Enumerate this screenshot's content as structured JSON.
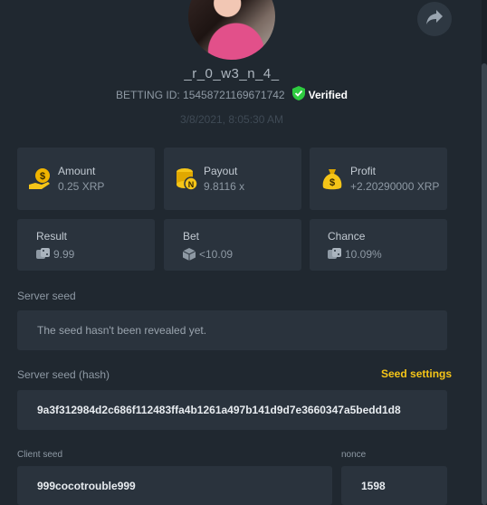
{
  "header": {
    "username": "_r_0_w3_n_4_",
    "bet_id": "BETTING ID: 15458721169671742",
    "verified_label": "Verified",
    "date": "3/8/2021, 8:05:30 AM"
  },
  "stats": {
    "amount": {
      "label": "Amount",
      "value": "0.25 XRP",
      "icon": "money-hand-icon"
    },
    "payout": {
      "label": "Payout",
      "value": "9.8116 x",
      "icon": "coins-stack-icon"
    },
    "profit": {
      "label": "Profit",
      "value": "+2.20290000 XRP",
      "icon": "money-bag-icon"
    },
    "result": {
      "label": "Result",
      "value": "9.99",
      "icon": "dice-icon"
    },
    "bet": {
      "label": "Bet",
      "value": "<10.09",
      "icon": "cube-icon"
    },
    "chance": {
      "label": "Chance",
      "value": "10.09%",
      "icon": "dice-icon"
    }
  },
  "seeds": {
    "server_seed_label": "Server seed",
    "server_seed_value": "The seed hasn't been revealed yet.",
    "server_hash_label": "Server seed (hash)",
    "seed_settings_label": "Seed settings",
    "server_hash_value": "9a3f312984d2c686f112483ffa4b1261a497b141d9d7e3660347a5bedd1d8",
    "client_seed_label": "Client seed",
    "client_seed_value": "999cocotrouble999",
    "nonce_label": "nonce",
    "nonce_value": "1598"
  },
  "colors": {
    "background": "#202830",
    "card": "#2a333d",
    "accent": "#f5c518",
    "verified": "#2ecc40"
  }
}
